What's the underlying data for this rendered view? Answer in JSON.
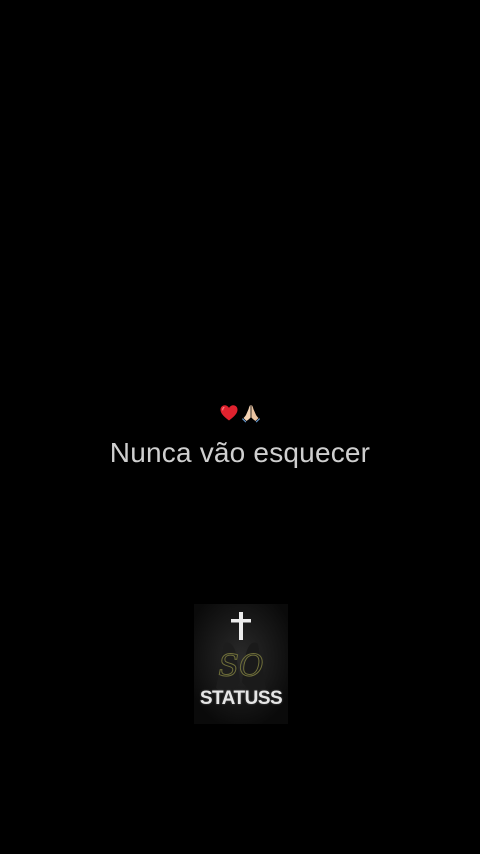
{
  "status": {
    "emojis": [
      "heart-emoji",
      "praying-hands-emoji"
    ],
    "text": "Nunca vão esquecer"
  },
  "watermark": {
    "text": "STATUSS",
    "script_mark": "SO",
    "icon": "cross-icon"
  },
  "colors": {
    "background": "#000000",
    "text": "#cfcfcf",
    "heart": "#e0222e"
  }
}
